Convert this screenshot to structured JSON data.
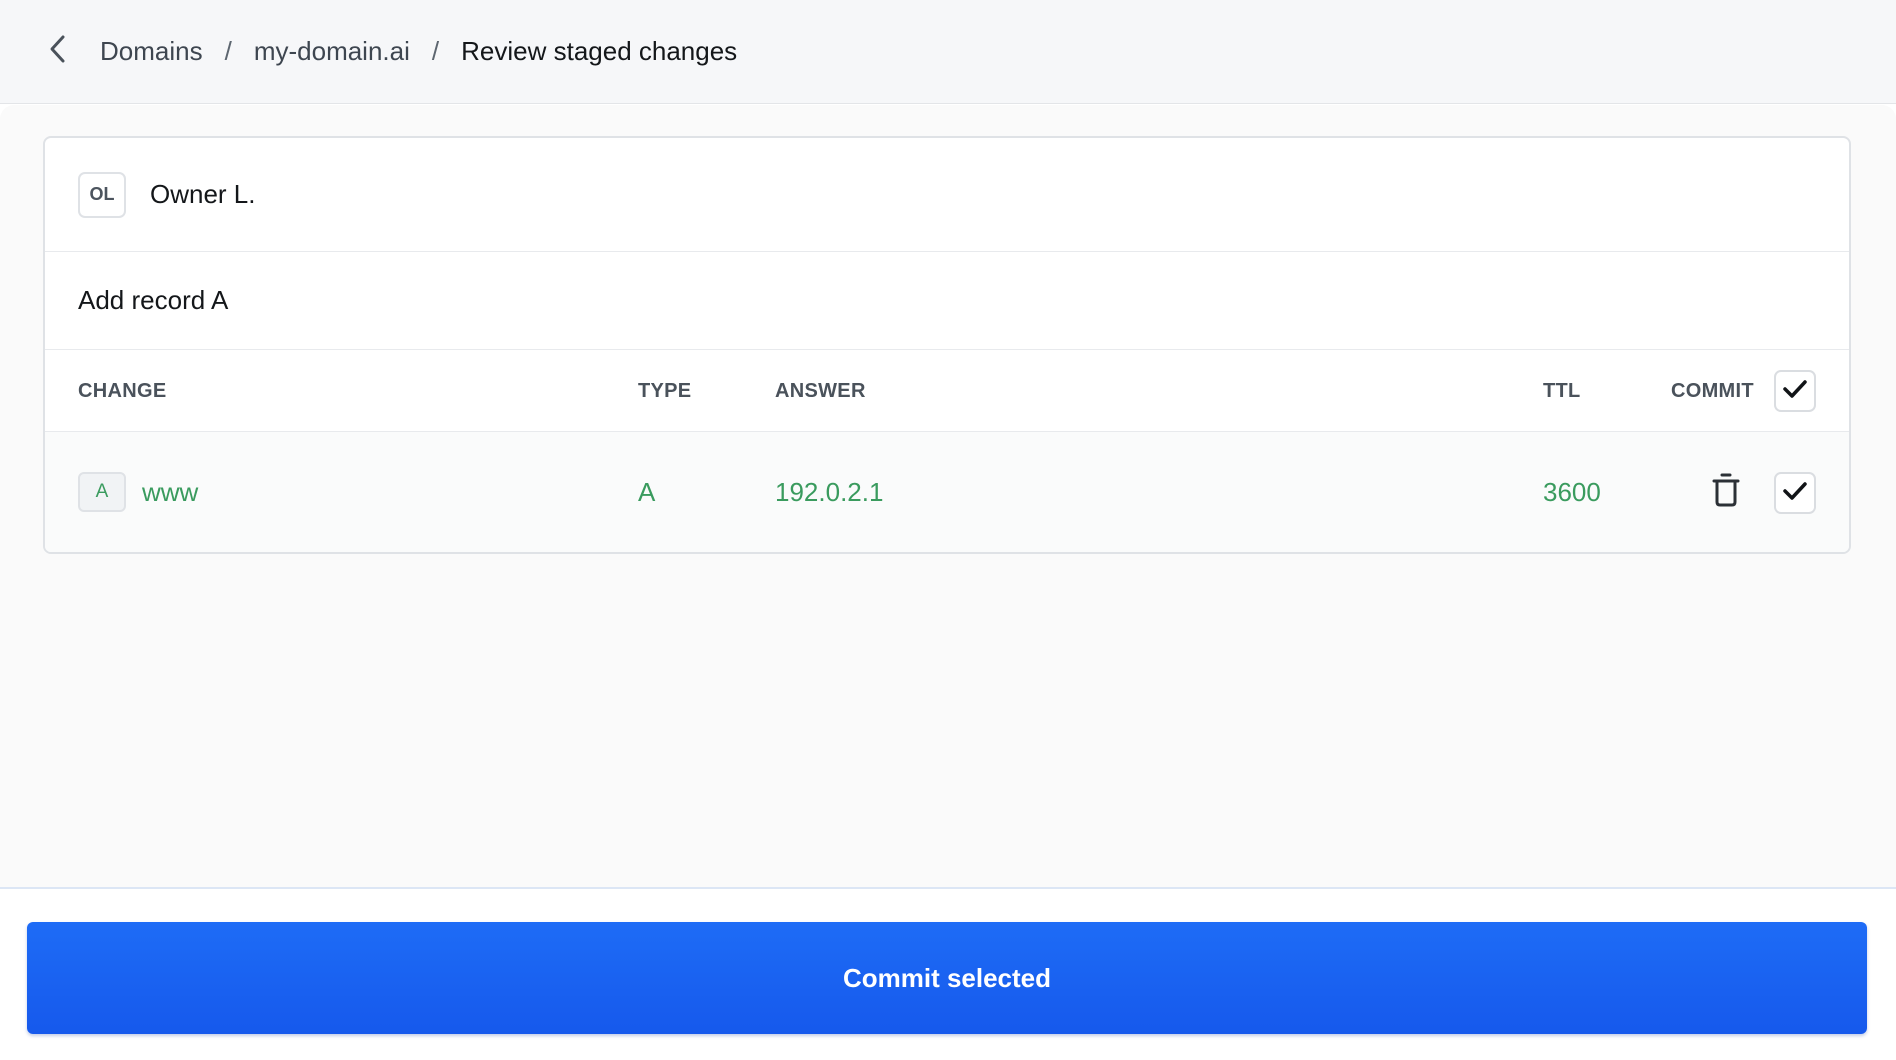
{
  "breadcrumb": {
    "items": [
      "Domains",
      "my-domain.ai",
      "Review staged changes"
    ],
    "separator": "/"
  },
  "owner": {
    "initials": "OL",
    "name": "Owner L."
  },
  "change_group": {
    "title": "Add record A"
  },
  "table": {
    "headers": {
      "change": "CHANGE",
      "type": "TYPE",
      "answer": "ANSWER",
      "ttl": "TTL",
      "commit": "COMMIT"
    },
    "rows": [
      {
        "badge": "A",
        "name": "www",
        "type": "A",
        "answer": "192.0.2.1",
        "ttl": "3600",
        "checked": true
      }
    ],
    "select_all_checked": true
  },
  "footer": {
    "commit_label": "Commit selected"
  },
  "colors": {
    "accent": "#1e6cf6",
    "added_text": "#3a9b5e"
  },
  "icons": {
    "back": "chevron-left-icon",
    "delete": "trash-icon",
    "check": "checkmark-icon"
  }
}
